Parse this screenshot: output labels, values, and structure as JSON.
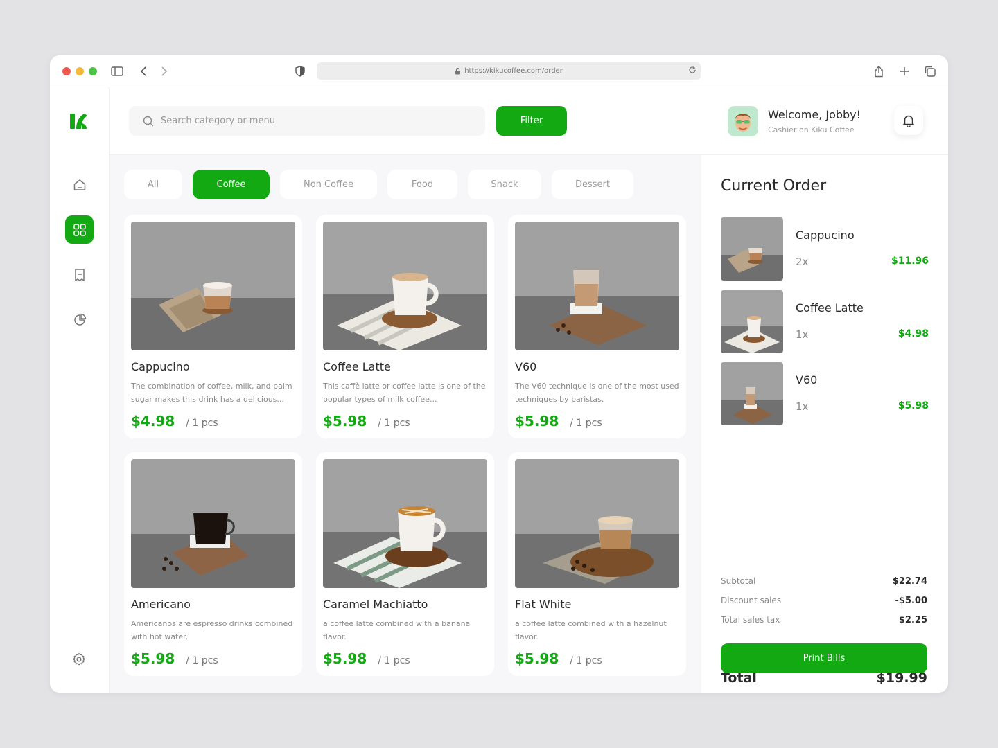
{
  "browser": {
    "url": "https://kikucoffee.com/order"
  },
  "search": {
    "placeholder": "Search category or menu"
  },
  "filter_label": "Filter",
  "user": {
    "welcome": "Welcome, Jobby!",
    "role": "Cashier on Kiku Coffee"
  },
  "categories": [
    "All",
    "Coffee",
    "Non Coffee",
    "Food",
    "Snack",
    "Dessert"
  ],
  "active_category": "Coffee",
  "products": [
    {
      "name": "Cappucino",
      "desc": "The combination of coffee, milk, and palm sugar makes this drink has a delicious...",
      "price": "$4.98",
      "unit": "/ 1 pcs"
    },
    {
      "name": "Coffee Latte",
      "desc": "This caffè latte or coffee latte is one of the popular types of milk coffee...",
      "price": "$5.98",
      "unit": "/ 1 pcs"
    },
    {
      "name": "V60",
      "desc": "The V60 technique is one of the most used techniques by baristas.",
      "price": "$5.98",
      "unit": "/ 1 pcs"
    },
    {
      "name": "Americano",
      "desc": "Americanos are espresso drinks combined with hot water.",
      "price": "$5.98",
      "unit": "/ 1 pcs"
    },
    {
      "name": "Caramel Machiatto",
      "desc": "a coffee latte combined with a banana flavor.",
      "price": "$5.98",
      "unit": "/ 1 pcs"
    },
    {
      "name": "Flat White",
      "desc": "a coffee latte combined with a hazelnut flavor.",
      "price": "$5.98",
      "unit": "/ 1 pcs"
    }
  ],
  "order": {
    "title": "Current Order",
    "items": [
      {
        "name": "Cappucino",
        "qty": "2x",
        "price": "$11.96"
      },
      {
        "name": "Coffee Latte",
        "qty": "1x",
        "price": "$4.98"
      },
      {
        "name": "V60",
        "qty": "1x",
        "price": "$5.98"
      }
    ],
    "subtotal_label": "Subtotal",
    "subtotal": "$22.74",
    "discount_label": "Discount sales",
    "discount": "-$5.00",
    "tax_label": "Total sales tax",
    "tax": "$2.25",
    "total_label": "Total",
    "total": "$19.99",
    "print_label": "Print Bills"
  },
  "colors": {
    "accent": "#12a912",
    "background": "#f7f7f9"
  }
}
